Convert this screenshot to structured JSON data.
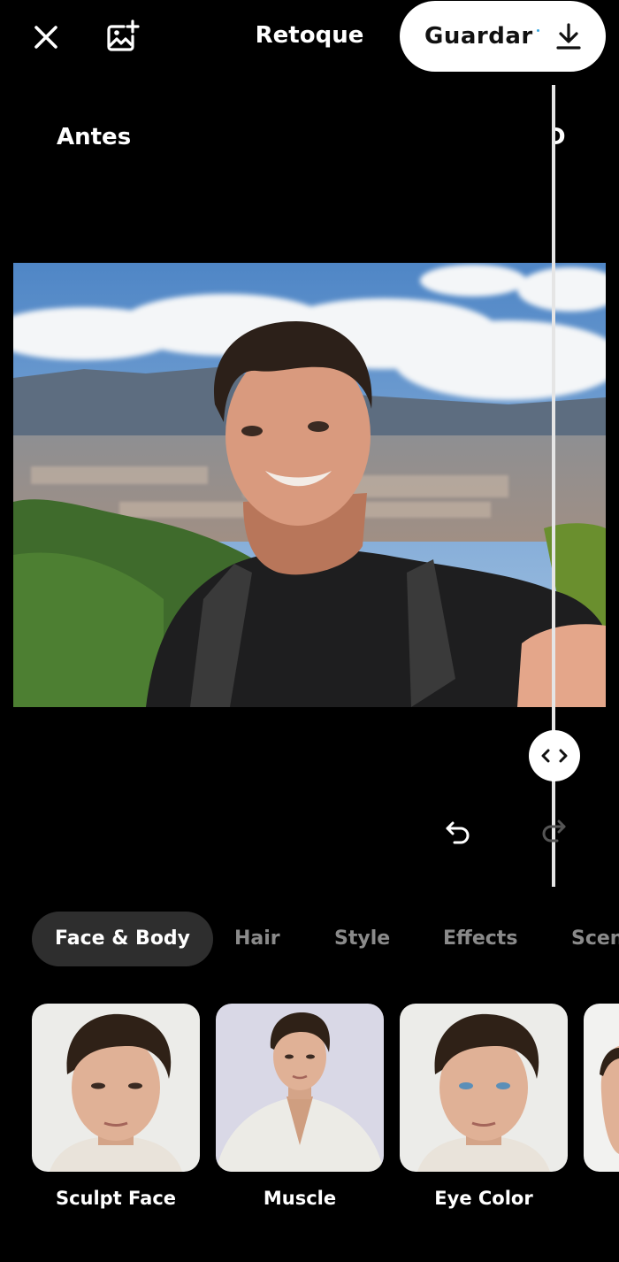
{
  "header": {
    "title": "Retoque",
    "save_label": "Guardar"
  },
  "compare": {
    "before_label": "Antes",
    "after_label": "Después"
  },
  "tabs": [
    {
      "label": "Face & Body",
      "active": true
    },
    {
      "label": "Hair",
      "active": false
    },
    {
      "label": "Style",
      "active": false
    },
    {
      "label": "Effects",
      "active": false
    },
    {
      "label": "Scenes",
      "active": false
    }
  ],
  "features": [
    {
      "label": "Sculpt Face"
    },
    {
      "label": "Muscle"
    },
    {
      "label": "Eye Color"
    },
    {
      "label": ""
    }
  ],
  "colors": {
    "background": "#000000",
    "active_tab_bg": "#2e2e2e",
    "inactive_tab_text": "#8a8a8a",
    "save_button_bg": "#ffffff"
  },
  "icons": [
    "close-icon",
    "add-photo-icon",
    "download-icon",
    "compare-handle-icon",
    "undo-icon",
    "redo-icon"
  ]
}
